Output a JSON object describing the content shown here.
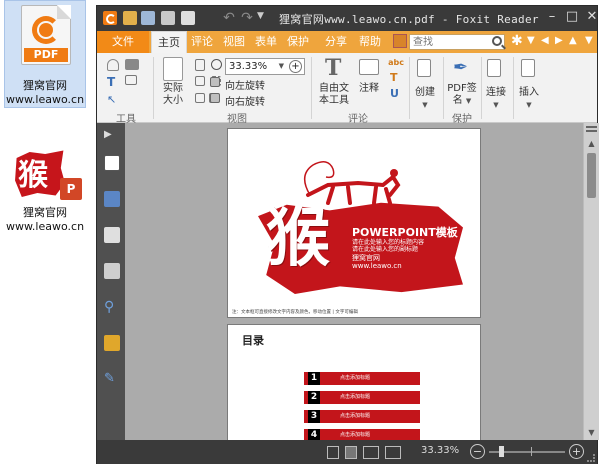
{
  "desktop": {
    "icon1": {
      "badge": "PDF",
      "line1": "狸窝官网",
      "line2": "www.leawo.cn"
    },
    "icon2": {
      "art_char": "猴",
      "line1": "狸窝官网",
      "line2": "www.leawo.cn"
    }
  },
  "window": {
    "title": "狸窝官网www.leawo.cn.pdf - Foxit Reader",
    "controls": {
      "minimize": "–",
      "maximize": "□",
      "close": "✕"
    },
    "quick_access": {
      "undo": "↶",
      "redo": "↷",
      "more": "▼"
    }
  },
  "menu": {
    "tabs": [
      "文件",
      "主页",
      "评论",
      "视图",
      "表单",
      "保护",
      "分享",
      "帮助"
    ],
    "search_placeholder": "查找",
    "gear": "✱"
  },
  "ribbon": {
    "tools_group": "工具",
    "view_group": "视图",
    "comment_group": "评论",
    "protect_group": "保护",
    "actual_size": [
      "实际",
      "大小"
    ],
    "zoom_value": "33.33%",
    "rotate_left": "向左旋转",
    "rotate_right": "向右旋转",
    "typewriter": [
      "自由文",
      "本工具"
    ],
    "note": "注释",
    "abc": "abc",
    "create": "创建",
    "pdf_sign": [
      "PDF签",
      "名"
    ],
    "link": "连接",
    "insert": "插入"
  },
  "document": {
    "page1": {
      "char": "猴",
      "title": "POWERPOINT模板",
      "lines": [
        "请在此处输入您的标题内容",
        "请在此处输入您的副标题",
        "狸窝官网",
        "www.leawo.cn"
      ],
      "footer": "注：文本框可直接修改文字内容及颜色，移动位置 | 文字可编辑"
    },
    "page2": {
      "title": "目录",
      "toc": [
        {
          "num": "1",
          "text": "点击添加标题"
        },
        {
          "num": "2",
          "text": "点击添加标题"
        },
        {
          "num": "3",
          "text": "点击添加标题"
        },
        {
          "num": "4",
          "text": "点击添加标题"
        }
      ]
    }
  },
  "statusbar": {
    "zoom": "33.33%",
    "minus": "−",
    "plus": "+"
  },
  "colors": {
    "accent_orange": "#efa53d",
    "file_tab": "#f28a17",
    "window_dark": "#3a3a3a",
    "brand_red": "#c3151b"
  }
}
